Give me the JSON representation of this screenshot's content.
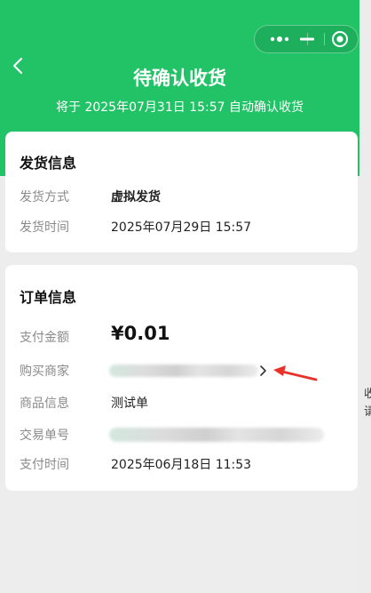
{
  "header": {
    "title": "待确认收货",
    "subtitle": "将于 2025年07月31日 15:57 自动确认收货"
  },
  "capsule": {
    "more_icon": "more-dots-icon",
    "minimize_icon": "minimize-icon",
    "close_icon": "close-circle-icon"
  },
  "shipping": {
    "title": "发货信息",
    "rows": [
      {
        "label": "发货方式",
        "value": "虚拟发货"
      },
      {
        "label": "发货时间",
        "value": "2025年07月29日 15:57"
      }
    ]
  },
  "order": {
    "title": "订单信息",
    "amount_label": "支付金额",
    "amount_value": "¥0.01",
    "merchant_label": "购买商家",
    "product_label": "商品信息",
    "product_value": "测试单",
    "trade_no_label": "交易单号",
    "pay_time_label": "支付时间",
    "pay_time_value": "2025年06月18日 11:53"
  },
  "edge": {
    "line1": "收",
    "line2": "请"
  },
  "colors": {
    "header_green": "#21c366",
    "annotation_red": "#e8332a"
  }
}
